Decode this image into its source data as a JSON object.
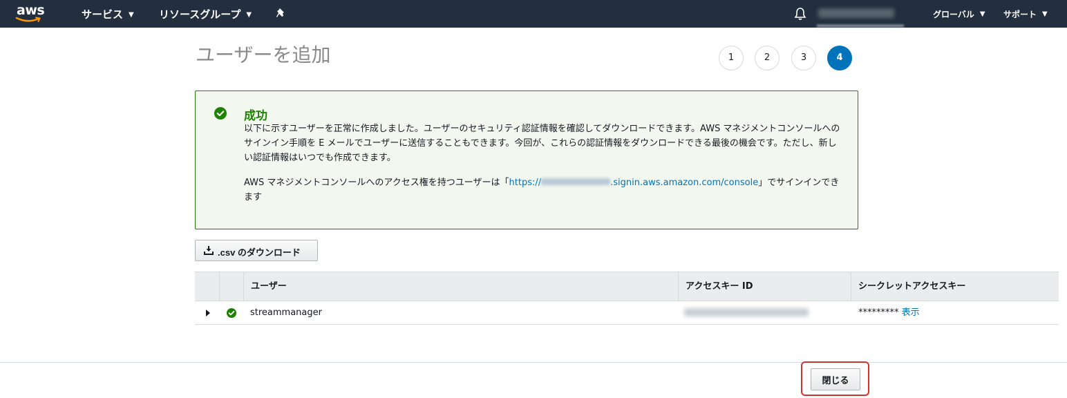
{
  "navbar": {
    "logo": "aws",
    "services_menu": "サービス",
    "resource_groups_menu": "リソースグループ",
    "region_menu": "グローバル",
    "support_menu": "サポート",
    "icons": [
      "pin-icon",
      "bell-icon",
      "chevron-down-icon"
    ]
  },
  "page": {
    "title": "ユーザーを追加",
    "steps": [
      "1",
      "2",
      "3",
      "4"
    ],
    "current_step": 4
  },
  "alert": {
    "title": "成功",
    "message": "以下に示すユーザーを正常に作成しました。ユーザーのセキュリティ認証情報を確認してダウンロードできます。AWS マネジメントコンソールへのサインイン手順を E メールでユーザーに送信することもできます。今回が、これらの認証情報をダウンロードできる最後の機会です。ただし、新しい認証情報はいつでも作成できます。",
    "signin_prefix": "AWS マネジメントコンソールへのアクセス権を持つユーザーは「",
    "signin_url_start": "https://",
    "signin_url_end": ".signin.aws.amazon.com/console",
    "signin_suffix": "」でサインインできます"
  },
  "download_button": ".csv のダウンロード",
  "table": {
    "columns": [
      "",
      "",
      "ユーザー",
      "アクセスキー ID",
      "シークレットアクセスキー"
    ],
    "rows": [
      {
        "user": "streammanager",
        "secret_mask": "*********",
        "show_link": "表示"
      }
    ]
  },
  "footer": {
    "close_button": "閉じる"
  },
  "colors": {
    "nav_bg": "#232f3e",
    "success_green": "#1d8102",
    "link_blue": "#0073bb",
    "highlight_red": "#d0342c"
  }
}
